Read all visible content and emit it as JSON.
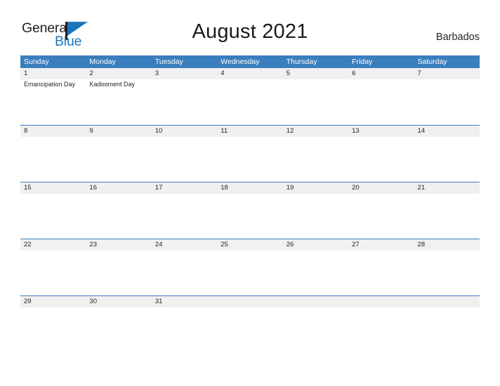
{
  "brand": {
    "name_part1": "General",
    "name_part2": "Blue",
    "flag_icon": "flag-triangle-icon",
    "color_dark": "#231f20",
    "color_blue": "#1b75bb"
  },
  "header": {
    "title": "August 2021",
    "country": "Barbados"
  },
  "theme": {
    "header_blue": "#3b7ebd",
    "band_gray": "#f0f0f0",
    "text_dark": "#231f20"
  },
  "calendar": {
    "weekdays": [
      "Sunday",
      "Monday",
      "Tuesday",
      "Wednesday",
      "Thursday",
      "Friday",
      "Saturday"
    ],
    "weeks": [
      [
        {
          "date": "1",
          "event": "Emancipation Day"
        },
        {
          "date": "2",
          "event": "Kadooment Day"
        },
        {
          "date": "3",
          "event": ""
        },
        {
          "date": "4",
          "event": ""
        },
        {
          "date": "5",
          "event": ""
        },
        {
          "date": "6",
          "event": ""
        },
        {
          "date": "7",
          "event": ""
        }
      ],
      [
        {
          "date": "8",
          "event": ""
        },
        {
          "date": "9",
          "event": ""
        },
        {
          "date": "10",
          "event": ""
        },
        {
          "date": "11",
          "event": ""
        },
        {
          "date": "12",
          "event": ""
        },
        {
          "date": "13",
          "event": ""
        },
        {
          "date": "14",
          "event": ""
        }
      ],
      [
        {
          "date": "15",
          "event": ""
        },
        {
          "date": "16",
          "event": ""
        },
        {
          "date": "17",
          "event": ""
        },
        {
          "date": "18",
          "event": ""
        },
        {
          "date": "19",
          "event": ""
        },
        {
          "date": "20",
          "event": ""
        },
        {
          "date": "21",
          "event": ""
        }
      ],
      [
        {
          "date": "22",
          "event": ""
        },
        {
          "date": "23",
          "event": ""
        },
        {
          "date": "24",
          "event": ""
        },
        {
          "date": "25",
          "event": ""
        },
        {
          "date": "26",
          "event": ""
        },
        {
          "date": "27",
          "event": ""
        },
        {
          "date": "28",
          "event": ""
        }
      ],
      [
        {
          "date": "29",
          "event": ""
        },
        {
          "date": "30",
          "event": ""
        },
        {
          "date": "31",
          "event": ""
        },
        {
          "date": "",
          "event": ""
        },
        {
          "date": "",
          "event": ""
        },
        {
          "date": "",
          "event": ""
        },
        {
          "date": "",
          "event": ""
        }
      ]
    ]
  }
}
